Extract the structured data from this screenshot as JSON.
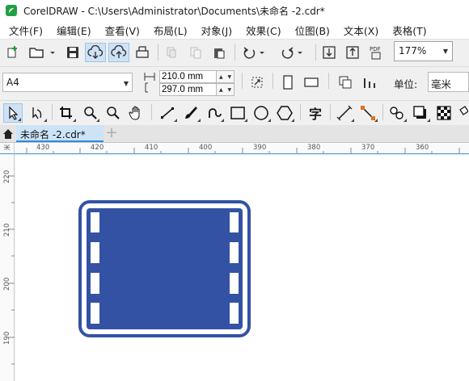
{
  "window": {
    "title": "CorelDRAW - C:\\Users\\Administrator\\Documents\\未命名 -2.cdr*"
  },
  "menu": {
    "items": [
      "文件(F)",
      "编辑(E)",
      "查看(V)",
      "布局(L)",
      "对象(J)",
      "效果(C)",
      "位图(B)",
      "文本(X)",
      "表格(T)"
    ]
  },
  "toolbar": {
    "zoom": "177%",
    "pdf_label": "PDF"
  },
  "property_bar": {
    "page_size": "A4",
    "width": "210.0 mm",
    "height": "297.0 mm",
    "units_label": "单位:",
    "units_value": "毫米"
  },
  "toolbox": {
    "text_tool_glyph": "字"
  },
  "document_tabs": {
    "active_tab": "未命名 -2.cdr*",
    "add_tab": "+"
  },
  "rulers": {
    "horizontal": [
      "430",
      "420",
      "410",
      "400",
      "390",
      "380",
      "370",
      "360"
    ],
    "vertical": [
      "220",
      "210",
      "200",
      "190"
    ],
    "corner_label": "米"
  },
  "colors": {
    "film_blue": "#3452a4",
    "selection_blue": "#cfe2f5",
    "tab_accent": "#2e8be0"
  }
}
